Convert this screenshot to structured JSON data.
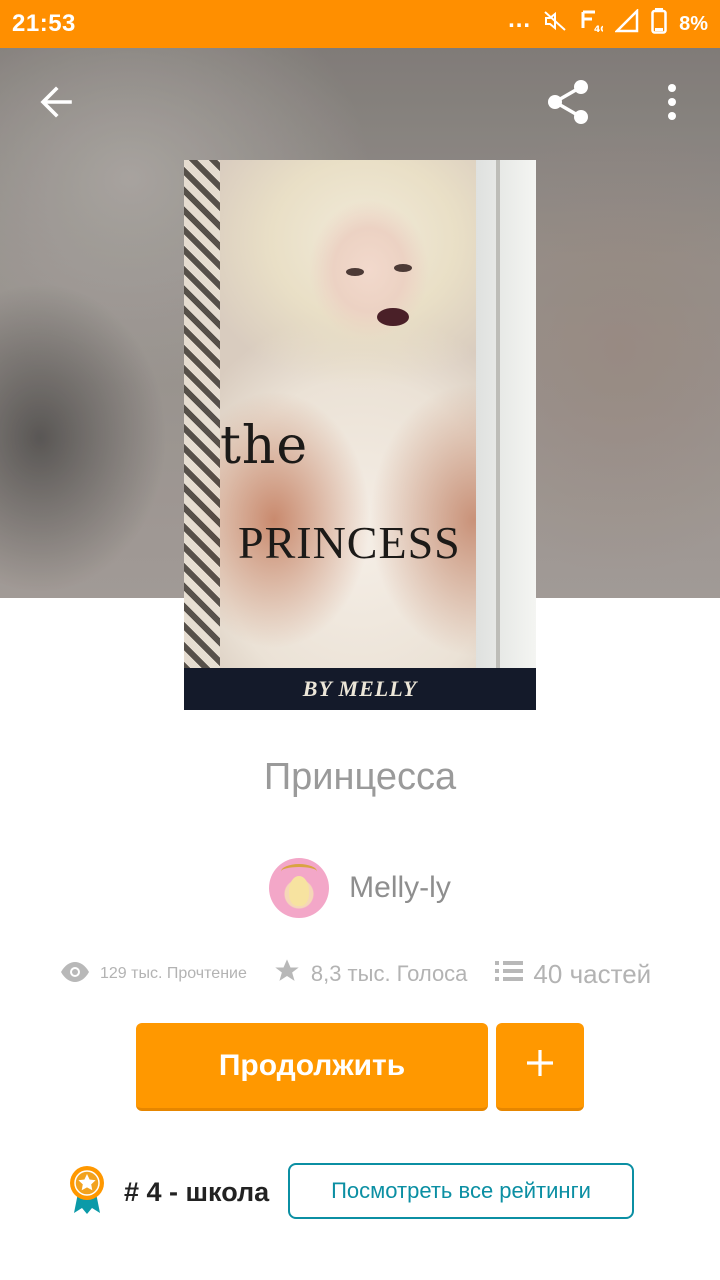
{
  "status_bar": {
    "time": "21:53",
    "dots": "...",
    "battery": "8%",
    "background_color": "#ff8f00"
  },
  "toolbar": {
    "back_icon": "arrow-left-icon",
    "share_icon": "share-icon",
    "more_icon": "more-vertical-icon"
  },
  "cover": {
    "title_the": "the",
    "title_main": "PRINCESS",
    "byline": "BY MELLY"
  },
  "story": {
    "title": "Принцесса",
    "author": "Melly-ly"
  },
  "stats": {
    "reads": "129 тыс. Прочтение",
    "votes": "8,3 тыс. Голоса",
    "parts": "40 частей"
  },
  "actions": {
    "continue_label": "Продолжить",
    "add_label": "+"
  },
  "ranking": {
    "rank_text": "# 4 - школа",
    "see_all_label": "Посмотреть все рейтинги"
  },
  "colors": {
    "accent": "#ff9800",
    "link": "#0b8fa3",
    "muted_text": "#9a9a9a"
  }
}
